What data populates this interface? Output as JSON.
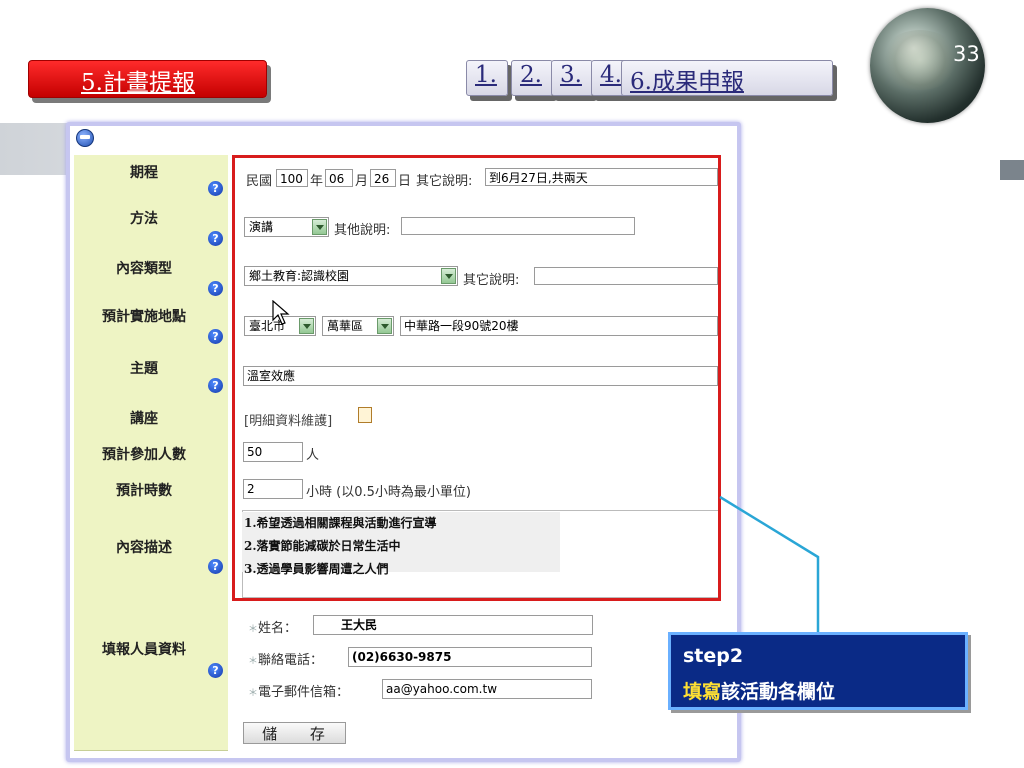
{
  "slide": {
    "page_number": "33"
  },
  "nav": {
    "active": "5.計畫提報",
    "steps": [
      "1.",
      "2.",
      "3.",
      "4.",
      "6.成果申報"
    ]
  },
  "form": {
    "rows": {
      "schedule": {
        "label": "期程",
        "prefix": "民國",
        "year": "100",
        "year_unit": "年",
        "month": "06",
        "month_unit": "月",
        "day": "26",
        "day_unit": "日",
        "note_label": "其它說明:",
        "note_value": "到6月27日,共兩天"
      },
      "method": {
        "label": "方法",
        "selected": "演講",
        "note_label": "其他說明:",
        "note_value": ""
      },
      "content_type": {
        "label": "內容類型",
        "selected": "鄉土教育:認識校園",
        "note_label": "其它說明:",
        "note_value": ""
      },
      "location": {
        "label": "預計實施地點",
        "city": "臺北市",
        "district": "萬華區",
        "address": "中華路一段90號20樓"
      },
      "topic": {
        "label": "主題",
        "value": "溫室效應"
      },
      "lecture": {
        "label": "講座",
        "link": "[明細資料維護]"
      },
      "participants": {
        "label": "預計參加人數",
        "value": "50",
        "unit": "人"
      },
      "hours": {
        "label": "預計時數",
        "value": "2",
        "unit": "小時 (以0.5小時為最小單位)"
      },
      "description": {
        "label": "內容描述",
        "lines": [
          "1.希望透過相關課程與活動進行宣導",
          "2.落實節能減碳於日常生活中",
          "3.透過學員影響周遭之人們"
        ]
      },
      "reporter": {
        "label": "填報人員資料",
        "name_label": "姓名：",
        "name": "王大民",
        "phone_label": "聯絡電話：",
        "phone": "(02)6630-9875",
        "email_label": "電子郵件信箱：",
        "email": "aa@yahoo.com.tw"
      }
    },
    "save_label": "儲 存"
  },
  "callout": {
    "step": "step2",
    "highlight": "填寫",
    "rest": "該活動各欄位"
  },
  "colors": {
    "accent_red": "#d81c1c",
    "label_bg": "#eef4c4",
    "callout_bg": "#0a2a86",
    "callout_highlight": "#ffe033"
  },
  "icons": [
    "globe-image",
    "help-icon",
    "form-icon",
    "edit-icon",
    "mouse-cursor-icon"
  ]
}
